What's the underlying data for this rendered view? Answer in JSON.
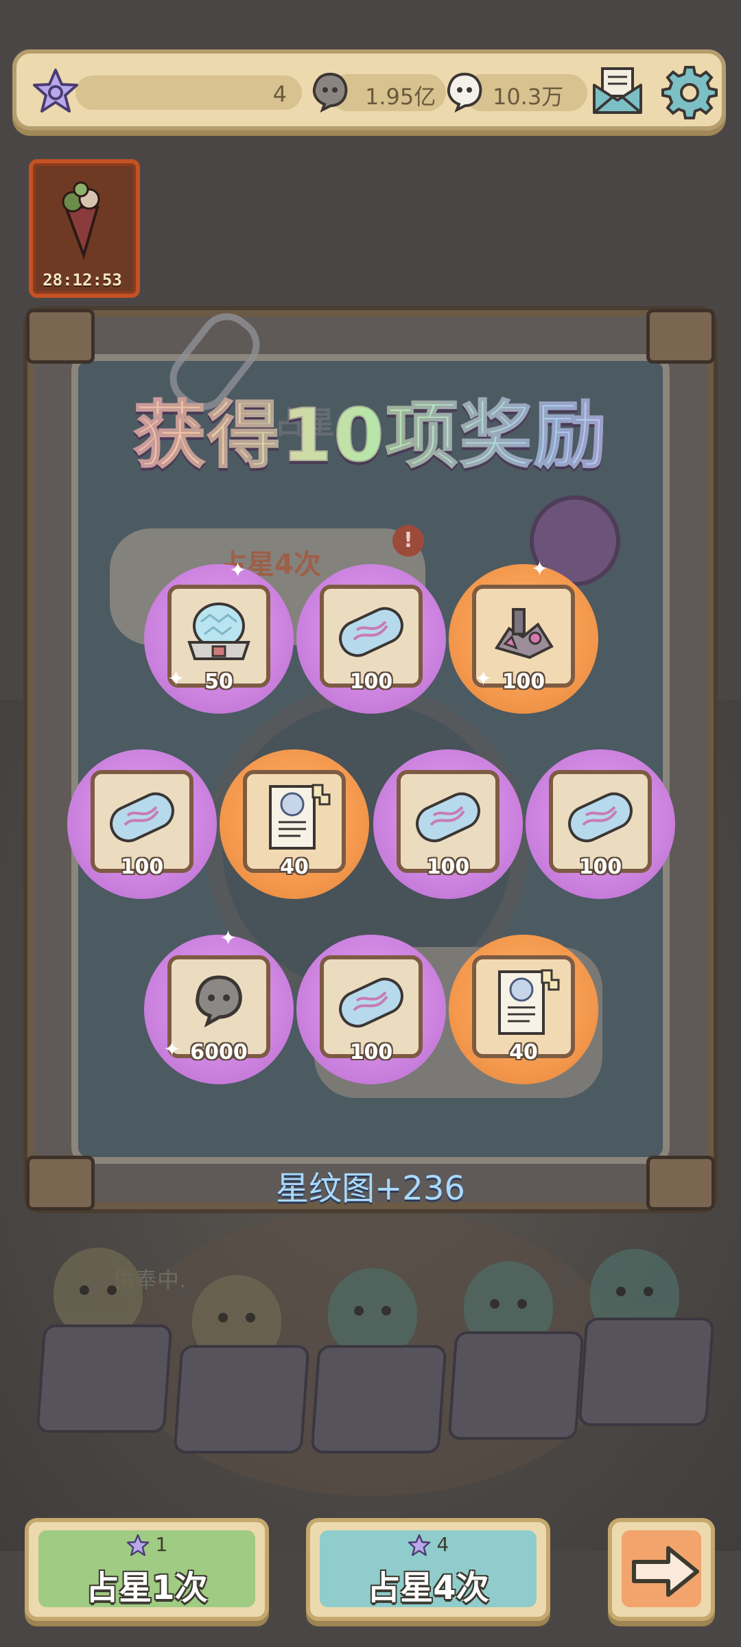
{
  "top_bar": {
    "star_count": "4",
    "currency_1": "1.95亿",
    "currency_2": "10.3万",
    "icons": [
      "star-icon",
      "soul-coin-icon",
      "ghost-coin-icon",
      "mail-icon",
      "gear-icon"
    ]
  },
  "event": {
    "timer": "28:12:53",
    "icon": "bouquet-icon"
  },
  "background": {
    "board_title": "占星",
    "bubble_text": "占星4次",
    "alert": "!",
    "scene_text": "供奉中."
  },
  "reward_popup": {
    "title": "获得10项奖励",
    "bonus_text": "星纹图+236",
    "rows": [
      [
        {
          "item": "crystal-dome-icon",
          "quantity": "50",
          "rarity": "purple"
        },
        {
          "item": "blue-capsule-icon",
          "quantity": "100",
          "rarity": "purple"
        },
        {
          "item": "machine-parts-icon",
          "quantity": "100",
          "rarity": "orange"
        }
      ],
      [
        {
          "item": "blue-capsule-icon",
          "quantity": "100",
          "rarity": "purple"
        },
        {
          "item": "scroll-fragment-icon",
          "quantity": "40",
          "rarity": "orange"
        },
        {
          "item": "blue-capsule-icon",
          "quantity": "100",
          "rarity": "purple"
        },
        {
          "item": "blue-capsule-icon",
          "quantity": "100",
          "rarity": "purple"
        }
      ],
      [
        {
          "item": "ghost-coin-icon",
          "quantity": "6000",
          "rarity": "purple"
        },
        {
          "item": "blue-capsule-icon",
          "quantity": "100",
          "rarity": "purple"
        },
        {
          "item": "scroll-fragment-icon",
          "quantity": "40",
          "rarity": "orange"
        }
      ]
    ]
  },
  "buttons": {
    "draw_one": {
      "cost": "1",
      "label": "占星1次",
      "color": "#9fcb83"
    },
    "draw_four": {
      "cost": "4",
      "label": "占星4次",
      "color": "#8fcccb"
    },
    "next": {
      "icon": "arrow-right-icon",
      "color": "#f2a46c"
    }
  }
}
